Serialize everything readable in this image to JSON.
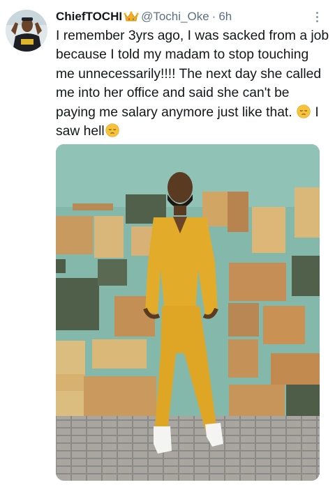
{
  "tweet": {
    "display_name": "ChiefTOCHI",
    "handle": "@Tochi_Oke",
    "separator": "·",
    "time": "6h",
    "text_main": "I remember 3yrs ago, I was sacked from a job because I told my madam to stop touching me unnecessarily!!!! The next day she called me into her office and said she can't be paying me salary anymore just like that.",
    "text_tail": "I saw hell",
    "crown_emoji": "crown",
    "sad_emoji": "pensive-face"
  }
}
